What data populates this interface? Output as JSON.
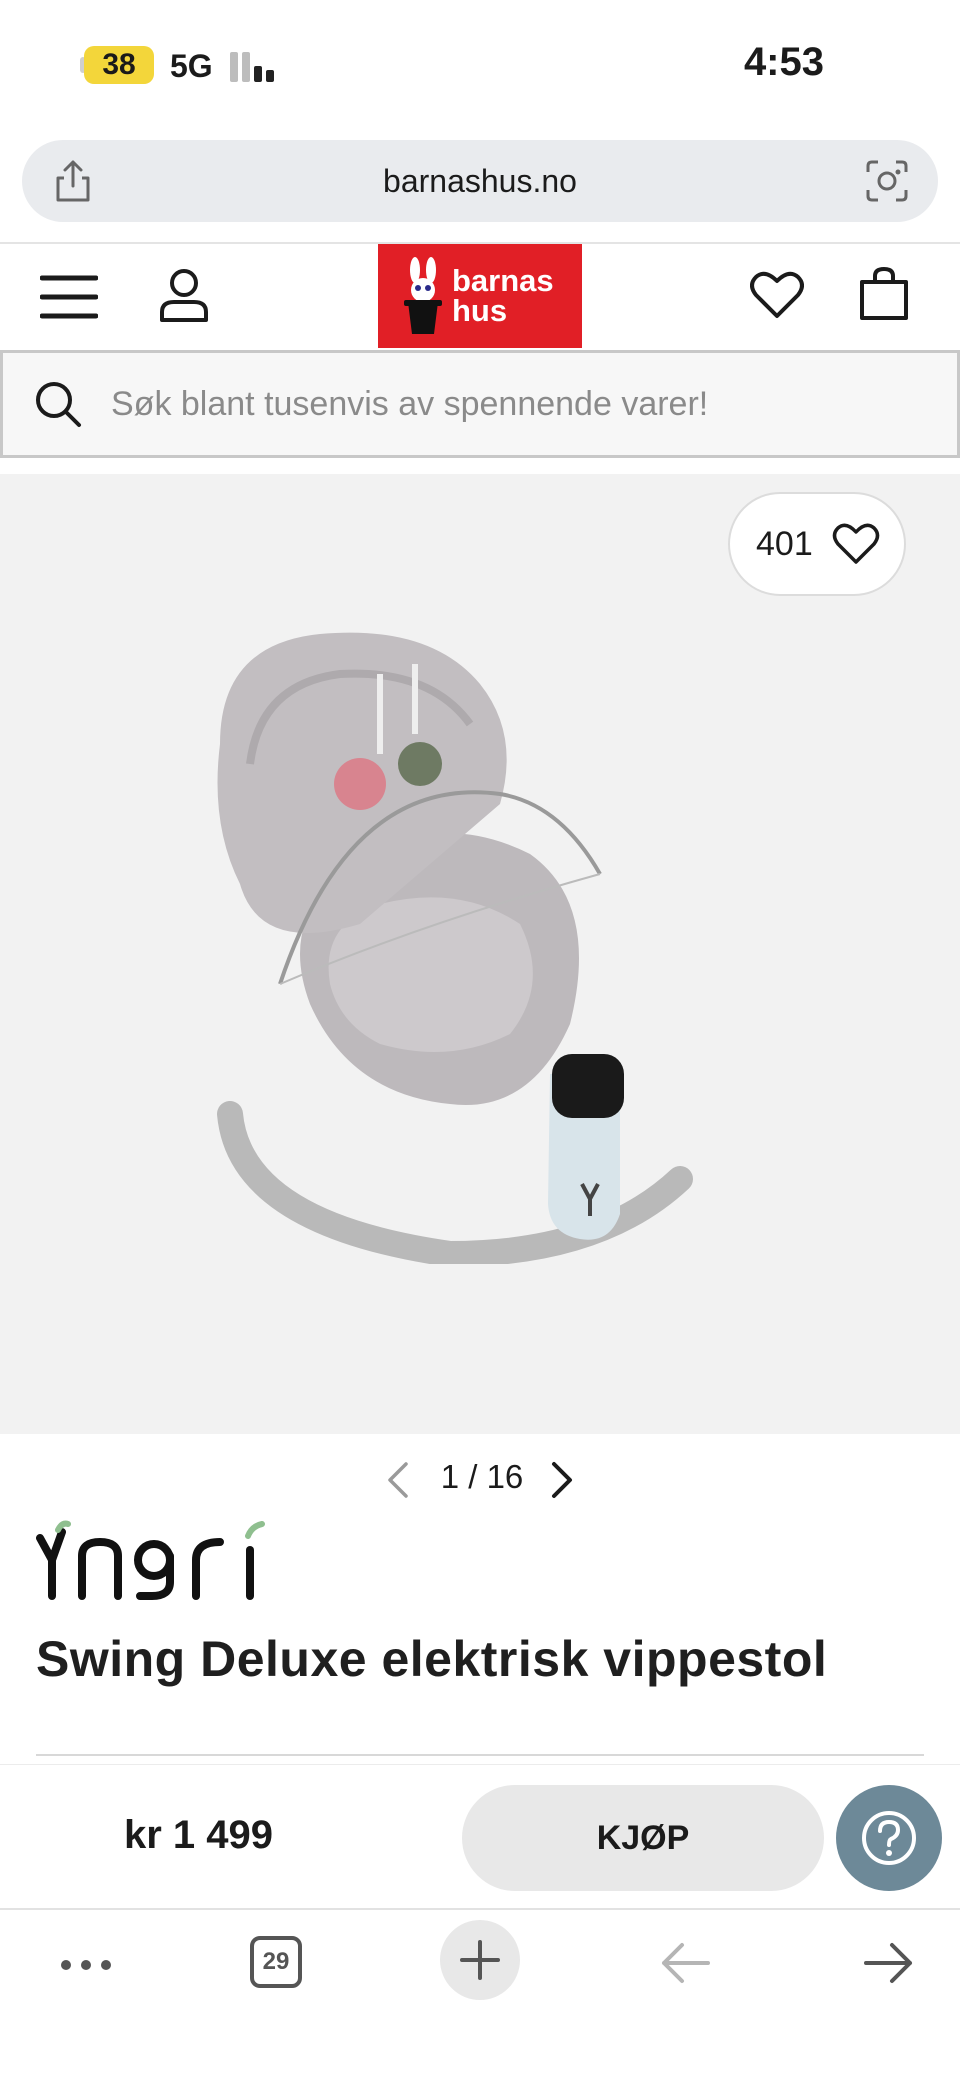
{
  "status_bar": {
    "battery": "38",
    "network": "5G",
    "time": "4:53"
  },
  "browser": {
    "url": "barnashus.no",
    "tab_count": "29"
  },
  "site_header": {
    "logo_line1": "barnas",
    "logo_line2": "hus",
    "brand_color": "#e11f26"
  },
  "search": {
    "placeholder": "Søk blant tusenvis av spennende varer!"
  },
  "product": {
    "favorite_count": "401",
    "image_index": "1",
    "image_total": "16",
    "brand": "Yngri",
    "title": "Swing Deluxe elektrisk vippestol",
    "price": "kr 1 499",
    "buy_label": "KJØP"
  },
  "colors": {
    "help_button": "#6d8998",
    "battery": "#f3d63a"
  },
  "icons": [
    "share-icon",
    "lens-icon",
    "menu-icon",
    "user-icon",
    "heart-icon",
    "bag-icon",
    "search-icon",
    "chevron-left-icon",
    "chevron-right-icon",
    "question-icon",
    "more-icon",
    "plus-icon",
    "back-arrow-icon",
    "forward-arrow-icon"
  ]
}
